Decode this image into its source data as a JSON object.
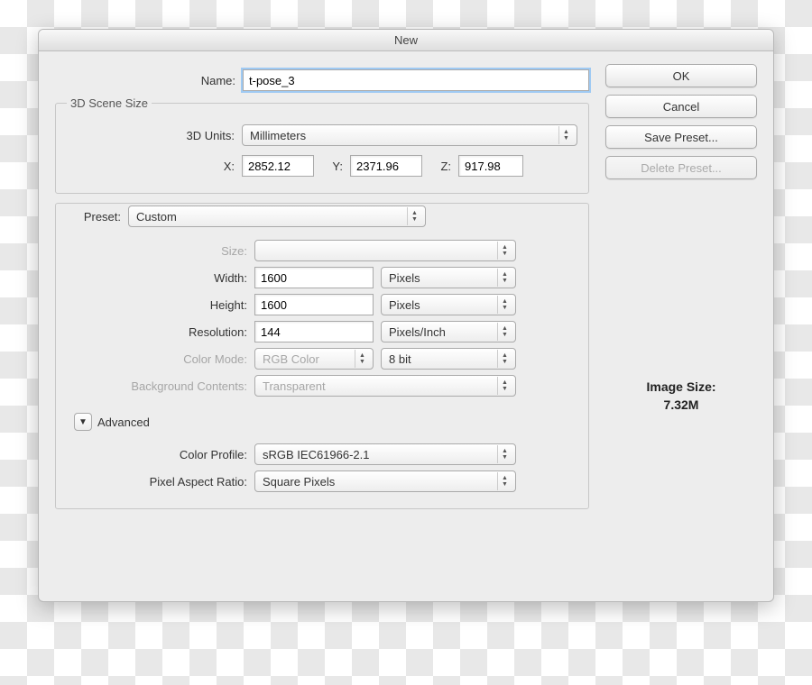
{
  "dialog": {
    "title": "New"
  },
  "name": {
    "label": "Name:",
    "value": "t-pose_3"
  },
  "scene": {
    "legend": "3D Scene Size",
    "units_label": "3D Units:",
    "units_value": "Millimeters",
    "x_label": "X:",
    "x_value": "2852.12",
    "y_label": "Y:",
    "y_value": "2371.96",
    "z_label": "Z:",
    "z_value": "917.98"
  },
  "preset": {
    "label": "Preset:",
    "value": "Custom",
    "size_label": "Size:",
    "size_value": "",
    "width_label": "Width:",
    "width_value": "1600",
    "width_unit": "Pixels",
    "height_label": "Height:",
    "height_value": "1600",
    "height_unit": "Pixels",
    "resolution_label": "Resolution:",
    "resolution_value": "144",
    "resolution_unit": "Pixels/Inch",
    "color_mode_label": "Color Mode:",
    "color_mode_value": "RGB Color",
    "color_depth_value": "8 bit",
    "background_label": "Background Contents:",
    "background_value": "Transparent"
  },
  "advanced": {
    "label": "Advanced",
    "color_profile_label": "Color Profile:",
    "color_profile_value": "sRGB IEC61966-2.1",
    "pixel_aspect_label": "Pixel Aspect Ratio:",
    "pixel_aspect_value": "Square Pixels"
  },
  "buttons": {
    "ok": "OK",
    "cancel": "Cancel",
    "save_preset": "Save Preset...",
    "delete_preset": "Delete Preset..."
  },
  "image_size": {
    "label": "Image Size:",
    "value": "7.32M"
  }
}
